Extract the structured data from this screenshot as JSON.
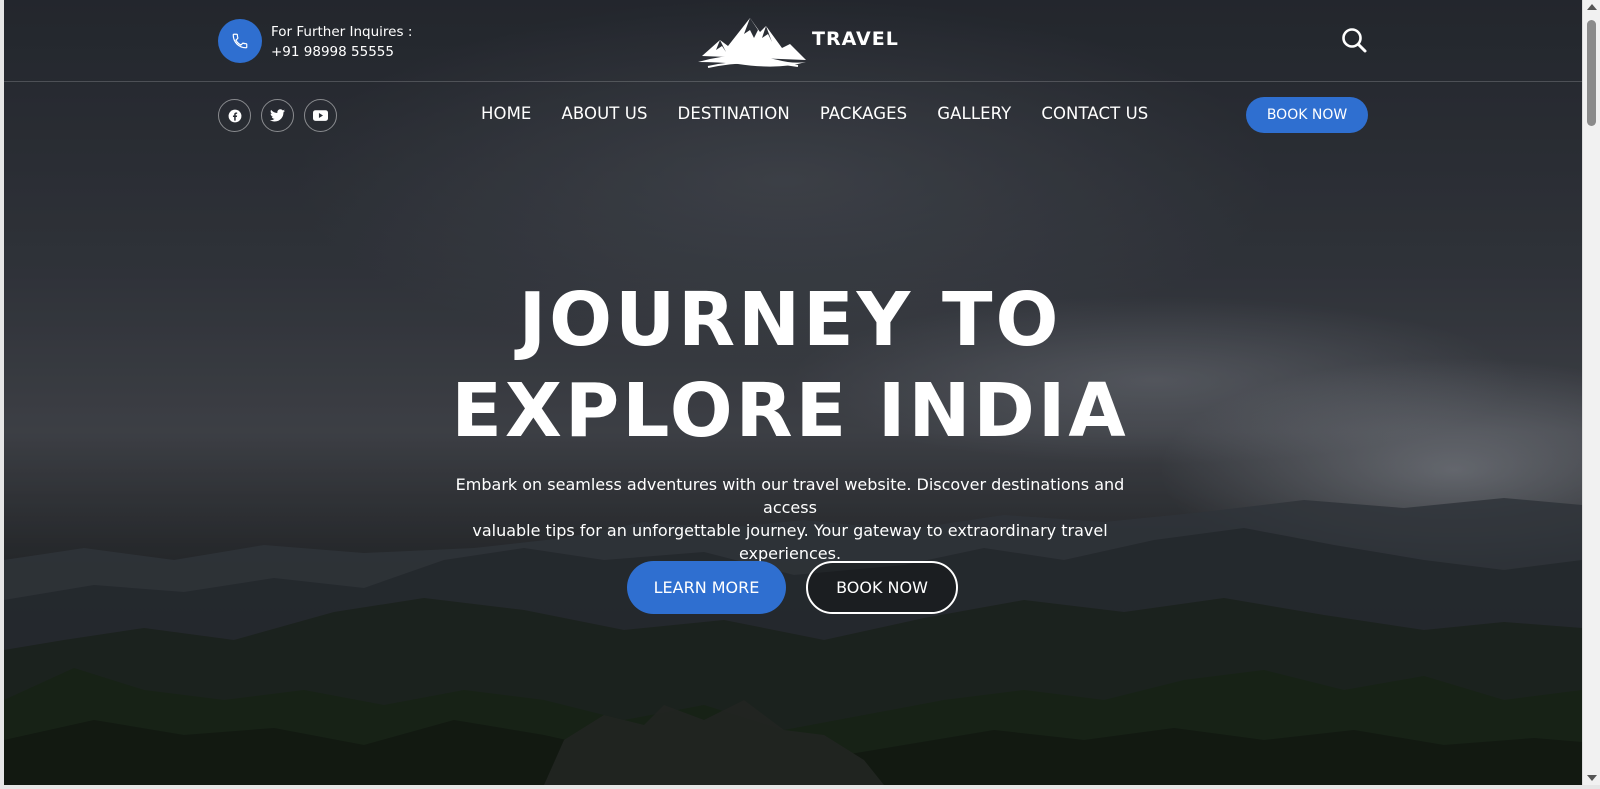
{
  "contact": {
    "label": "For Further Inquires :",
    "phone": "+91 98998 55555"
  },
  "brand": {
    "name": "TRAVEL"
  },
  "nav": {
    "items": [
      {
        "label": "HOME"
      },
      {
        "label": "ABOUT US"
      },
      {
        "label": "DESTINATION"
      },
      {
        "label": "PACKAGES"
      },
      {
        "label": "GALLERY"
      },
      {
        "label": "CONTACT US"
      }
    ],
    "book_label": "BOOK NOW"
  },
  "social": [
    "facebook-icon",
    "twitter-icon",
    "youtube-icon"
  ],
  "hero": {
    "title_line1": "JOURNEY TO",
    "title_line2": "EXPLORE INDIA",
    "description_line1": "Embark on seamless adventures with our travel website. Discover destinations and access",
    "description_line2": "valuable tips for an unforgettable journey. Your gateway to extraordinary travel experiences.",
    "learn_more_label": "LEARN MORE",
    "book_now_label": "BOOK NOW"
  },
  "colors": {
    "accent": "#2f6fd0",
    "text": "#ffffff"
  }
}
